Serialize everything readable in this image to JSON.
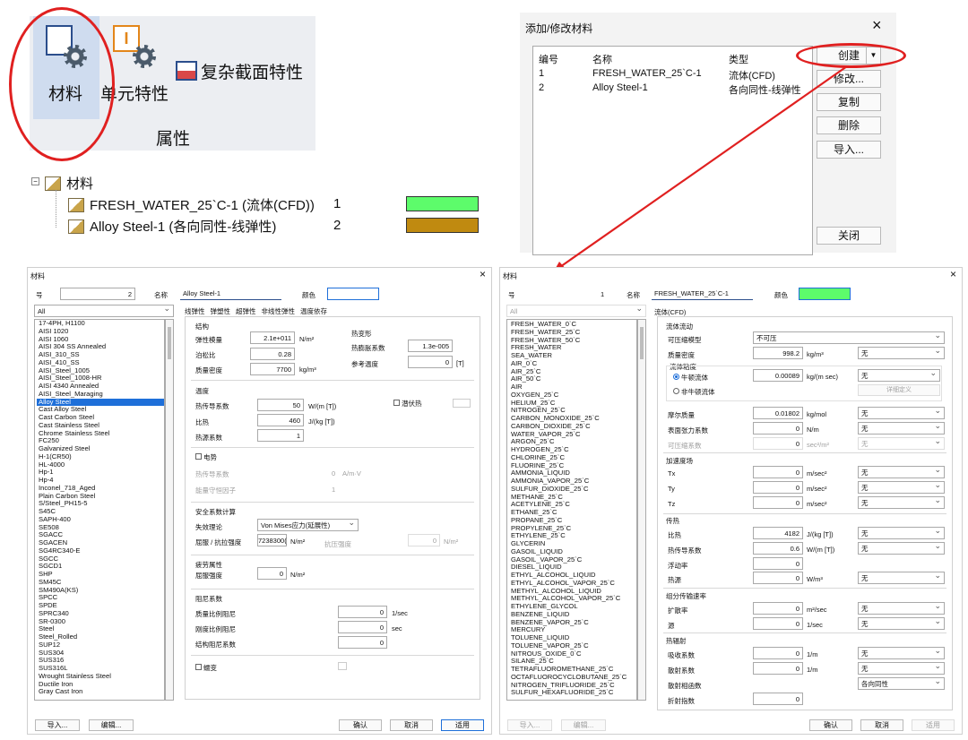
{
  "ribbon": {
    "material": "材料",
    "element": "单元特性",
    "complex": "复杂截面特性",
    "group": "属性"
  },
  "tree": {
    "root": "材料",
    "items": [
      {
        "name": "FRESH_WATER_25`C-1 (流体(CFD))",
        "id": "1",
        "color": "#5dfc6b"
      },
      {
        "name": "Alloy Steel-1 (各向同性-线弹性)",
        "id": "2",
        "color": "#c08a10"
      }
    ]
  },
  "add_dialog": {
    "title": "添加/修改材料",
    "close": "×",
    "headers": [
      "编号",
      "名称",
      "类型"
    ],
    "rows": [
      [
        "1",
        "FRESH_WATER_25`C-1",
        "流体(CFD)"
      ],
      [
        "2",
        "Alloy Steel-1",
        "各向同性-线弹性"
      ]
    ],
    "buttons": {
      "create": "创建",
      "modify": "修改...",
      "copy": "复制",
      "delete": "删除",
      "import": "导入...",
      "close": "关闭"
    }
  },
  "left_dialog": {
    "title": "材料",
    "close": "×",
    "no_label": "号",
    "no_value": "2",
    "name_label": "名称",
    "name_value": "Alloy Steel-1",
    "color_label": "颜色",
    "filter": "All",
    "list": [
      "17-4PH, H1100",
      "AISI 1020",
      "AISI 1060",
      "AISI 304 SS Annealed",
      "AISI_310_SS",
      "AISI_410_SS",
      "AISI_Steel_1005",
      "AISI_Steel_1008-HR",
      "AISI 4340 Annealed",
      "AISI_Steel_Maraging",
      "Alloy Steel",
      "Cast Alloy Steel",
      "Cast Carbon Steel",
      "Cast Stainless Steel",
      "Chrome Stainless Steel",
      "FC250",
      "Galvanized Steel",
      "H-1(CR50)",
      "HL-4000",
      "Hp-1",
      "Hp-4",
      "Inconel_718_Aged",
      "Plain Carbon Steel",
      "S/Steel_PH15-5",
      "S45C",
      "SAPH-400",
      "SE508",
      "SGACC",
      "SGACEN",
      "SG4RC340-E",
      "SGCC",
      "SGCD1",
      "SHP",
      "SM45C",
      "SM490A(KS)",
      "SPCC",
      "SPDE",
      "SPRC340",
      "SR-0300",
      "Steel",
      "Steel_Rolled",
      "SUP12",
      "SUS304",
      "SUS316",
      "SUS316L",
      "Wrought Stainless Steel",
      "Ductile Iron",
      "Gray Cast Iron"
    ],
    "selected": "Alloy Steel",
    "tabs": [
      "线弹性",
      "弹塑性",
      "超弹性",
      "非线性弹性",
      "温度依存"
    ],
    "structure": "结构",
    "E_label": "弹性模量",
    "E_value": "2.1e+011",
    "E_unit": "N/m²",
    "nu_label": "泊松比",
    "nu_value": "0.28",
    "rho_label": "质量密度",
    "rho_value": "7700",
    "rho_unit": "kg/m³",
    "thermal_def": "热变形",
    "alpha_label": "热膨胀系数",
    "alpha_value": "1.3e-005",
    "tref_label": "参考温度",
    "tref_value": "0",
    "tref_unit": "[T]",
    "temp": "温度",
    "k_label": "热传导系数",
    "k_value": "50",
    "k_unit": "W/(m [T])",
    "cp_label": "比热",
    "cp_value": "460",
    "cp_unit": "J/(kg [T])",
    "h_label": "热源系数",
    "h_value": "1",
    "latent": "潜伏热",
    "elec": "电势",
    "ec_label": "热传导系数",
    "ec_value": "0",
    "ec_unit": "A/m·V",
    "joule_label": "能量守恒因子",
    "joule_value": "1",
    "safety": "安全系数计算",
    "theory_label": "失效理论",
    "theory_value": "Von Mises应力(延展性)",
    "ys_label": "屈服 / 抗拉强度",
    "ys_value": "7238300(",
    "ys_unit": "N/m²",
    "ts_label": "抗压强度",
    "ts_value": "0",
    "ts_unit": "N/m²",
    "fatigue": "疲劳属性",
    "fs_label": "屈服强度",
    "fs_value": "0",
    "fs_unit": "N/m²",
    "damping": "阻尼系数",
    "md_label": "质量比例阻尼",
    "md_value": "0",
    "md_unit": "1/sec",
    "sd_label": "刚度比例阻尼",
    "sd_value": "0",
    "sd_unit": "sec",
    "st_label": "结构阻尼系数",
    "st_value": "0",
    "creep": "蠕变",
    "btn_import": "导入...",
    "btn_edit": "编辑...",
    "btn_ok": "确认",
    "btn_cancel": "取消",
    "btn_apply": "适用"
  },
  "right_dialog": {
    "title": "材料",
    "close": "×",
    "no_label": "号",
    "no_value": "1",
    "name_label": "名称",
    "name_value": "FRESH_WATER_25`C-1",
    "color_label": "颜色",
    "filter": "All",
    "cfd": "流体(CFD)",
    "list": [
      "FRESH_WATER_0`C",
      "FRESH_WATER_25`C",
      "FRESH_WATER_50`C",
      "FRESH_WATER",
      "SEA_WATER",
      "AIR_0`C",
      "AIR_25`C",
      "AIR_50`C",
      "AIR",
      "OXYGEN_25`C",
      "HELIUM_25`C",
      "NITROGEN_25`C",
      "CARBON_MONOXIDE_25`C",
      "CARBON_DIOXIDE_25`C",
      "WATER_VAPOR_25`C",
      "ARGON_25`C",
      "HYDROGEN_25`C",
      "CHLORINE_25`C",
      "FLUORINE_25`C",
      "AMMONIA_LIQUID",
      "AMMONIA_VAPOR_25`C",
      "SULFUR_DIOXIDE_25`C",
      "METHANE_25`C",
      "ACETYLENE_25`C",
      "ETHANE_25`C",
      "PROPANE_25`C",
      "PROPYLENE_25`C",
      "ETHYLENE_25`C",
      "GLYCERIN",
      "GASOIL_LIQUID",
      "GASOIL_VAPOR_25`C",
      "DIESEL_LIQUID",
      "ETHYL_ALCOHOL_LIQUID",
      "ETHYL_ALCOHOL_VAPOR_25`C",
      "METHYL_ALCOHOL_LIQUID",
      "METHYL_ALCOHOL_VAPOR_25`C",
      "ETHYLENE_GLYCOL",
      "BENZENE_LIQUID",
      "BENZENE_VAPOR_25`C",
      "MERCURY",
      "TOLUENE_LIQUID",
      "TOLUENE_VAPOR_25`C",
      "NITROUS_OXIDE_0`C",
      "SILANE_25`C",
      "TETRAFLUOROMETHANE_25`C",
      "OCTAFLUOROCYCLOBUTANE_25`C",
      "NITROGEN_TRIFLUORIDE_25`C",
      "SULFUR_HEXAFLUORIDE_25`C"
    ],
    "flow": "流体流动",
    "comp_label": "可压缩模型",
    "comp_value": "不可压",
    "dens_label": "质量密度",
    "dens_value": "998.2",
    "dens_unit": "kg/m³",
    "none": "无",
    "visc": "流体粘度",
    "newton": "牛顿流体",
    "visc_value": "0.00089",
    "visc_unit": "kg/(m sec)",
    "non_newton": "非牛顿流体",
    "detail": "详细定义",
    "mw_label": "摩尔质量",
    "mw_value": "0.01802",
    "mw_unit": "kg/mol",
    "st_label": "表面张力系数",
    "st_value": "0",
    "st_unit": "N/m",
    "cs_label": "可压缩系数",
    "cs_value": "0",
    "cs_unit": "sec²/m²",
    "accel": "加速度场",
    "tx": "Tx",
    "ty": "Ty",
    "tz": "Tz",
    "a_value": "0",
    "a_unit": "m/sec²",
    "heat": "传热",
    "cp_label": "比热",
    "cp_value": "4182",
    "cp_unit": "J/(kg [T])",
    "k_label": "热传导系数",
    "k_value": "0.6",
    "k_unit": "W/(m [T])",
    "buoy_label": "浮动率",
    "buoy_value": "0",
    "hs_label": "热源",
    "hs_value": "0",
    "hs_unit": "W/m³",
    "species": "组分传输速率",
    "diff_label": "扩散率",
    "diff_value": "0",
    "diff_unit": "m²/sec",
    "src_label": "源",
    "src_value": "0",
    "src_unit": "1/sec",
    "rad": "热辐射",
    "abs_label": "吸收系数",
    "abs_value": "0",
    "abs_unit": "1/m",
    "sc_label": "散射系数",
    "sc_value": "0",
    "sc_unit": "1/m",
    "ph_label": "散射相函数",
    "ph_value": "各向同性",
    "ri_label": "折射指数",
    "ri_value": "0",
    "btn_import": "导入...",
    "btn_edit": "编辑...",
    "btn_ok": "确认",
    "btn_cancel": "取消",
    "btn_apply": "适用"
  },
  "colors": {
    "red": "#e02020",
    "water": "#5dfc6b",
    "steel": "#c08a10",
    "select": "#1e6fd9"
  }
}
